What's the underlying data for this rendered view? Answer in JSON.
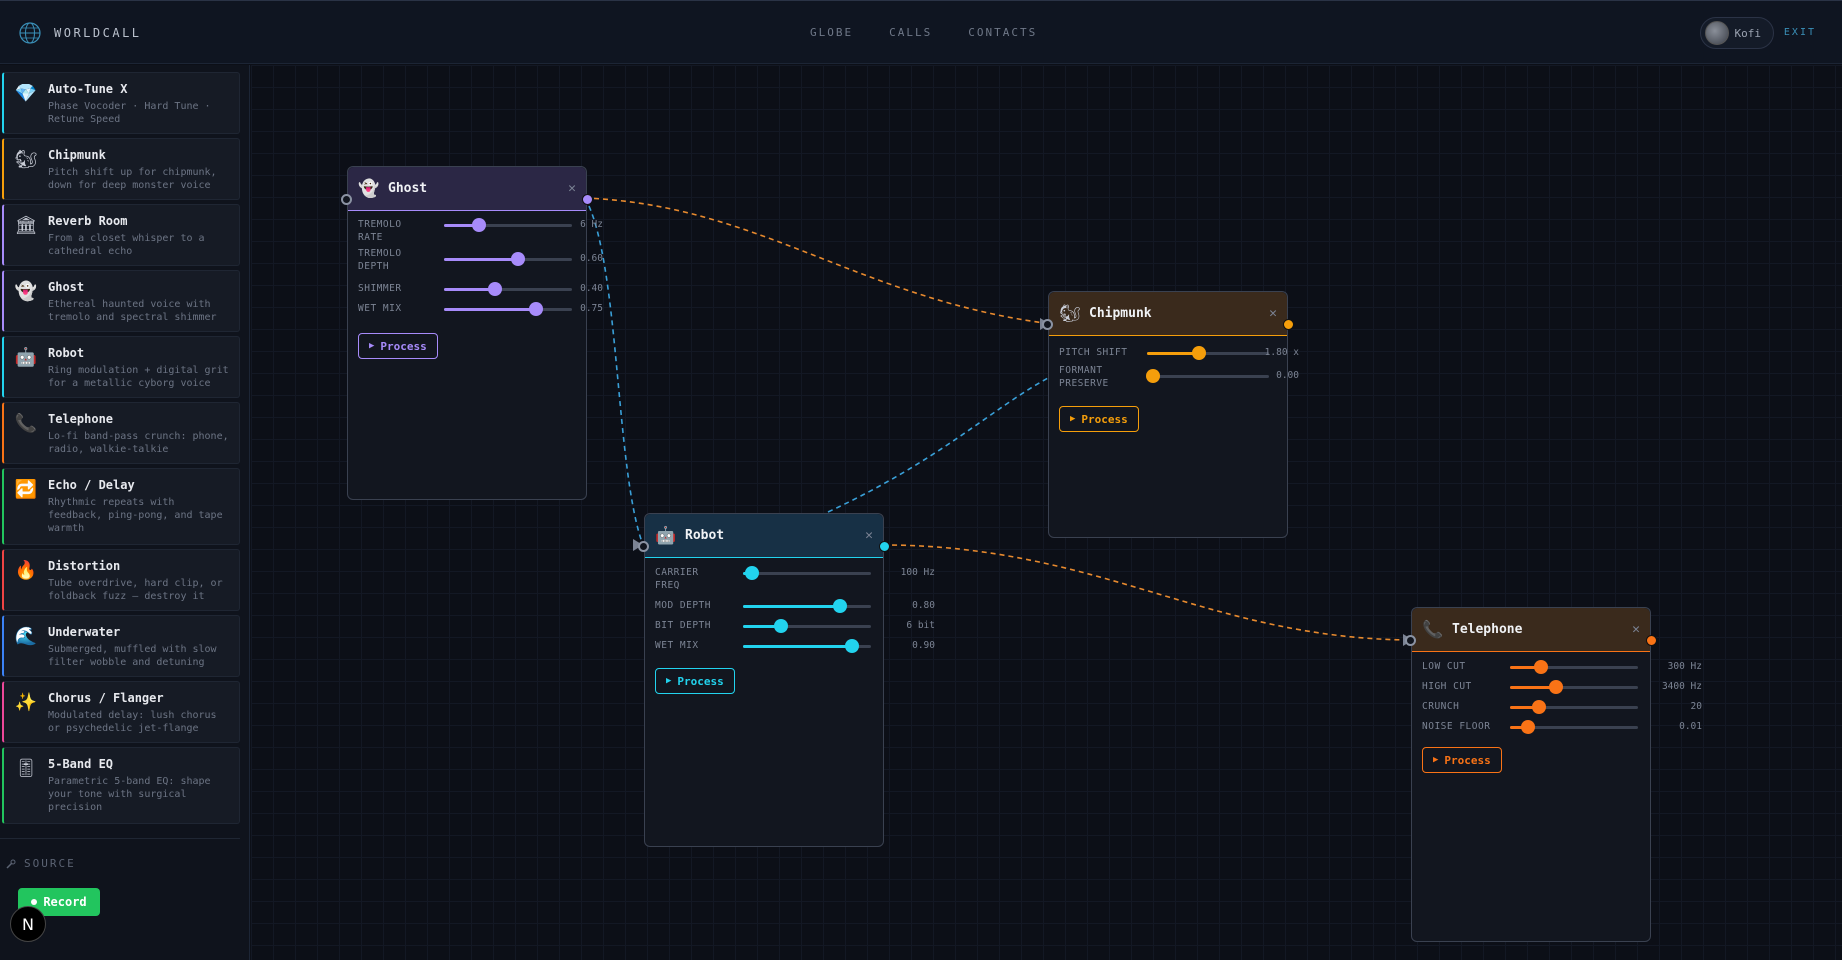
{
  "app": {
    "brand": "WORLDCALL",
    "icon": "globe-icon"
  },
  "nav": [
    "GLOBE",
    "CALLS",
    "CONTACTS"
  ],
  "user": {
    "name": "Kofi",
    "exit_label": "EXIT"
  },
  "sidebar": {
    "effects": [
      {
        "icon": "💎",
        "title": "Auto-Tune X",
        "desc": "Phase Vocoder · Hard Tune · Retune Speed",
        "color": "#22d3ee"
      },
      {
        "icon": "🐿",
        "title": "Chipmunk",
        "desc": "Pitch shift up for chipmunk, down for deep monster voice",
        "color": "#f59e0b"
      },
      {
        "icon": "🏛",
        "title": "Reverb Room",
        "desc": "From a closet whisper to a cathedral echo",
        "color": "#a78bfa"
      },
      {
        "icon": "👻",
        "title": "Ghost",
        "desc": "Ethereal haunted voice with tremolo and spectral shimmer",
        "color": "#a78bfa"
      },
      {
        "icon": "🤖",
        "title": "Robot",
        "desc": "Ring modulation + digital grit for a metallic cyborg voice",
        "color": "#22d3ee"
      },
      {
        "icon": "📞",
        "title": "Telephone",
        "desc": "Lo-fi band-pass crunch: phone, radio, walkie-talkie",
        "color": "#f97316"
      },
      {
        "icon": "🔁",
        "title": "Echo / Delay",
        "desc": "Rhythmic repeats with feedback, ping-pong, and tape warmth",
        "color": "#22c55e"
      },
      {
        "icon": "🔥",
        "title": "Distortion",
        "desc": "Tube overdrive, hard clip, or foldback fuzz — destroy it",
        "color": "#ef4444"
      },
      {
        "icon": "🌊",
        "title": "Underwater",
        "desc": "Submerged, muffled with slow filter wobble and detuning",
        "color": "#3b82f6"
      },
      {
        "icon": "✨",
        "title": "Chorus / Flanger",
        "desc": "Modulated delay: lush chorus or psychedelic jet-flange",
        "color": "#ec4899"
      },
      {
        "icon": "🎚",
        "title": "5-Band EQ",
        "desc": "Parametric 5-band EQ: shape your tone with surgical precision",
        "color": "#22c55e"
      }
    ],
    "source_label": "SOURCE",
    "record_label": "Record",
    "badge": "N"
  },
  "nodes": {
    "ghost": {
      "title": "Ghost",
      "icon": "👻",
      "accent": "#a78bfa",
      "header_bg": "#2b2745",
      "params": [
        {
          "label": "TREMOLO RATE",
          "value": "6 Hz",
          "level": 0.27
        },
        {
          "label": "TREMOLO DEPTH",
          "value": "0.60",
          "level": 0.58
        },
        {
          "label": "SHIMMER",
          "value": "0.40",
          "level": 0.4
        },
        {
          "label": "WET MIX",
          "value": "0.75",
          "level": 0.72
        }
      ],
      "process_label": "Process"
    },
    "chipmunk": {
      "title": "Chipmunk",
      "icon": "🐿",
      "accent": "#f59e0b",
      "header_bg": "#3a2a1c",
      "params": [
        {
          "label": "PITCH SHIFT",
          "value": "1.80 x",
          "level": 0.43
        },
        {
          "label": "FORMANT PRESERVE",
          "value": "0.00",
          "level": 0.05
        }
      ],
      "process_label": "Process"
    },
    "robot": {
      "title": "Robot",
      "icon": "🤖",
      "accent": "#22d3ee",
      "header_bg": "#173045",
      "params": [
        {
          "label": "CARRIER FREQ",
          "value": "100 Hz",
          "level": 0.07
        },
        {
          "label": "MOD DEPTH",
          "value": "0.80",
          "level": 0.76
        },
        {
          "label": "BIT DEPTH",
          "value": "6 bit",
          "level": 0.3
        },
        {
          "label": "WET MIX",
          "value": "0.90",
          "level": 0.85
        }
      ],
      "process_label": "Process"
    },
    "telephone": {
      "title": "Telephone",
      "icon": "📞",
      "accent": "#f97316",
      "header_bg": "#3a2a1c",
      "params": [
        {
          "label": "LOW CUT",
          "value": "300 Hz",
          "level": 0.24
        },
        {
          "label": "HIGH CUT",
          "value": "3400 Hz",
          "level": 0.36
        },
        {
          "label": "CRUNCH",
          "value": "20",
          "level": 0.23
        },
        {
          "label": "NOISE FLOOR",
          "value": "0.01",
          "level": 0.14
        }
      ],
      "process_label": "Process"
    }
  },
  "colors": {
    "wire_orange": "#e88a2e",
    "wire_blue": "#3aa0d8"
  }
}
